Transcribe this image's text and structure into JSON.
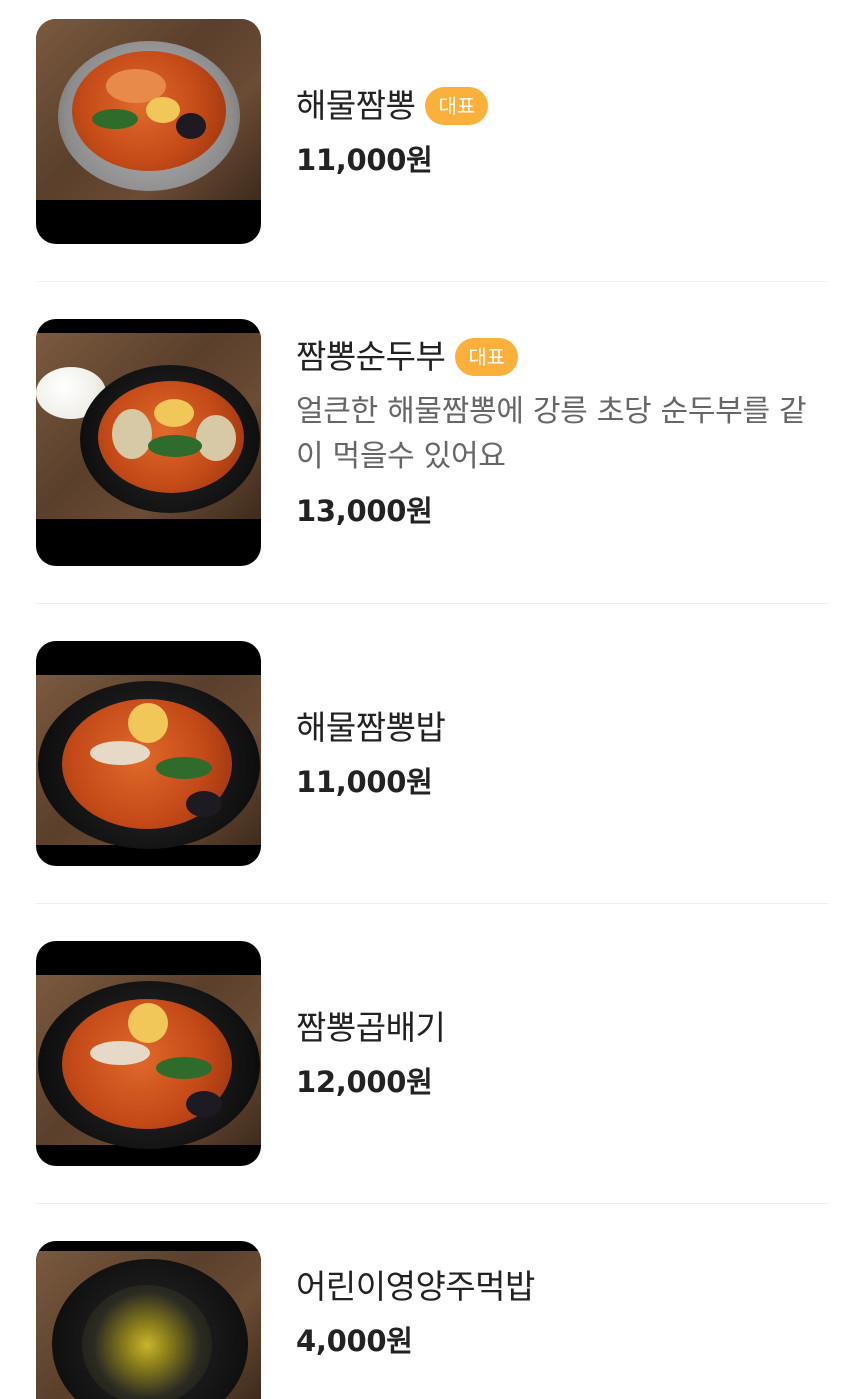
{
  "menu": {
    "items": [
      {
        "name": "해물짬뽕",
        "badge": "대표",
        "description": "",
        "price": "11,000원",
        "image_icon": "seafood-jjamppong-photo"
      },
      {
        "name": "짬뽕순두부",
        "badge": "대표",
        "description": "얼큰한 해물짬뽕에 강릉 초당 순두부를 같이 먹을수 있어요",
        "price": "13,000원",
        "image_icon": "jjamppong-soft-tofu-photo"
      },
      {
        "name": "해물짬뽕밥",
        "badge": "",
        "description": "",
        "price": "11,000원",
        "image_icon": "seafood-jjamppong-rice-photo"
      },
      {
        "name": "짬뽕곱배기",
        "badge": "",
        "description": "",
        "price": "12,000원",
        "image_icon": "jjamppong-large-photo"
      },
      {
        "name": "어린이영양주먹밥",
        "badge": "",
        "description": "",
        "price": "4,000원",
        "image_icon": "kids-rice-ball-photo"
      }
    ]
  },
  "colors": {
    "badge_bg": "#fbb03b",
    "badge_text": "#ffffff",
    "name_text": "#222222",
    "desc_text": "#666666",
    "divider": "#efefef"
  }
}
